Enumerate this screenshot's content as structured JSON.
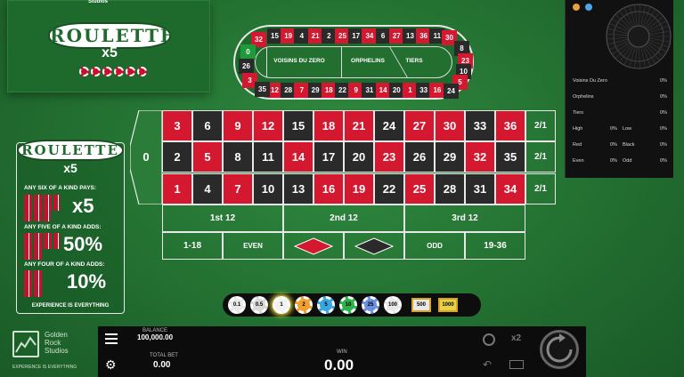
{
  "logo": {
    "brand_small": "Studios",
    "title": "ROULETTE",
    "multiplier": "x5"
  },
  "racetrack": {
    "top_numbers": [
      {
        "n": "15",
        "c": "black"
      },
      {
        "n": "19",
        "c": "red"
      },
      {
        "n": "4",
        "c": "black"
      },
      {
        "n": "21",
        "c": "red"
      },
      {
        "n": "2",
        "c": "black"
      },
      {
        "n": "25",
        "c": "red"
      },
      {
        "n": "17",
        "c": "black"
      },
      {
        "n": "34",
        "c": "red"
      },
      {
        "n": "6",
        "c": "black"
      },
      {
        "n": "27",
        "c": "red"
      },
      {
        "n": "13",
        "c": "black"
      },
      {
        "n": "36",
        "c": "red"
      },
      {
        "n": "11",
        "c": "black"
      }
    ],
    "bottom_numbers": [
      {
        "n": "12",
        "c": "red"
      },
      {
        "n": "28",
        "c": "black"
      },
      {
        "n": "7",
        "c": "red"
      },
      {
        "n": "29",
        "c": "black"
      },
      {
        "n": "18",
        "c": "red"
      },
      {
        "n": "22",
        "c": "black"
      },
      {
        "n": "9",
        "c": "red"
      },
      {
        "n": "31",
        "c": "black"
      },
      {
        "n": "14",
        "c": "red"
      },
      {
        "n": "20",
        "c": "black"
      },
      {
        "n": "1",
        "c": "red"
      },
      {
        "n": "33",
        "c": "black"
      },
      {
        "n": "16",
        "c": "red"
      }
    ],
    "left_numbers": [
      {
        "n": "32",
        "c": "red"
      },
      {
        "n": "0",
        "c": "green"
      },
      {
        "n": "26",
        "c": "black"
      },
      {
        "n": "3",
        "c": "red"
      },
      {
        "n": "35",
        "c": "black"
      }
    ],
    "right_numbers": [
      {
        "n": "30",
        "c": "red"
      },
      {
        "n": "8",
        "c": "black"
      },
      {
        "n": "23",
        "c": "red"
      },
      {
        "n": "10",
        "c": "black"
      },
      {
        "n": "5",
        "c": "red"
      },
      {
        "n": "24",
        "c": "black"
      }
    ],
    "labels": [
      "VOISINS DU ZERO",
      "ORPHELINS",
      "TIERS"
    ]
  },
  "history": {
    "rows": [
      {
        "label": "Voisins Du Zero",
        "value": "0%"
      },
      {
        "label": "Orphelins",
        "value": "0%"
      },
      {
        "label": "Tiers",
        "value": "0%"
      },
      {
        "label": "High",
        "value": "0%",
        "label2": "Low",
        "value2": "0%"
      },
      {
        "label": "Red",
        "value": "0%",
        "label2": "Black",
        "value2": "0%"
      },
      {
        "label": "Even",
        "value": "0%",
        "label2": "Odd",
        "value2": "0%"
      }
    ]
  },
  "table": {
    "zero": "0",
    "rows": [
      [
        {
          "n": "3",
          "c": "red"
        },
        {
          "n": "6",
          "c": "black"
        },
        {
          "n": "9",
          "c": "red"
        },
        {
          "n": "12",
          "c": "red"
        },
        {
          "n": "15",
          "c": "black"
        },
        {
          "n": "18",
          "c": "red"
        },
        {
          "n": "21",
          "c": "red"
        },
        {
          "n": "24",
          "c": "black"
        },
        {
          "n": "27",
          "c": "red"
        },
        {
          "n": "30",
          "c": "red"
        },
        {
          "n": "33",
          "c": "black"
        },
        {
          "n": "36",
          "c": "red"
        }
      ],
      [
        {
          "n": "2",
          "c": "black"
        },
        {
          "n": "5",
          "c": "red"
        },
        {
          "n": "8",
          "c": "black"
        },
        {
          "n": "11",
          "c": "black"
        },
        {
          "n": "14",
          "c": "red"
        },
        {
          "n": "17",
          "c": "black"
        },
        {
          "n": "20",
          "c": "black"
        },
        {
          "n": "23",
          "c": "red"
        },
        {
          "n": "26",
          "c": "black"
        },
        {
          "n": "29",
          "c": "black"
        },
        {
          "n": "32",
          "c": "red"
        },
        {
          "n": "35",
          "c": "black"
        }
      ],
      [
        {
          "n": "1",
          "c": "red"
        },
        {
          "n": "4",
          "c": "black"
        },
        {
          "n": "7",
          "c": "red"
        },
        {
          "n": "10",
          "c": "black"
        },
        {
          "n": "13",
          "c": "black"
        },
        {
          "n": "16",
          "c": "red"
        },
        {
          "n": "19",
          "c": "red"
        },
        {
          "n": "22",
          "c": "black"
        },
        {
          "n": "25",
          "c": "red"
        },
        {
          "n": "28",
          "c": "black"
        },
        {
          "n": "31",
          "c": "black"
        },
        {
          "n": "34",
          "c": "red"
        }
      ]
    ],
    "column_bets": [
      "2/1",
      "2/1",
      "2/1"
    ],
    "dozens": [
      "1st 12",
      "2nd 12",
      "3rd 12"
    ],
    "outside": {
      "low": "1-18",
      "even": "EVEN",
      "odd": "ODD",
      "high": "19-36"
    }
  },
  "paytable": {
    "title": "ROULETTE",
    "multiplier": "x5",
    "six_label": "ANY SIX OF A KIND PAYS:",
    "six_value": "x5",
    "five_label": "ANY FIVE OF A KIND ADDS:",
    "five_value": "50%",
    "four_label": "ANY FOUR OF A KIND ADDS:",
    "four_value": "10%",
    "tagline": "EXPERIENCE IS EVERYTHING"
  },
  "chips": [
    {
      "label": "0.1",
      "color": "#e8e8e8"
    },
    {
      "label": "0.5",
      "color": "#d9d9d9"
    },
    {
      "label": "1",
      "color": "#f2f2f2"
    },
    {
      "label": "2",
      "color": "#f0a030"
    },
    {
      "label": "5",
      "color": "#3aa6e0"
    },
    {
      "label": "10",
      "color": "#2bb34a"
    },
    {
      "label": "25",
      "color": "#6a8fe0"
    },
    {
      "label": "100",
      "color": "#e8e8e8"
    }
  ],
  "chips_rect": [
    {
      "label": "500",
      "color": "#e8e8e8"
    },
    {
      "label": "1000",
      "color": "#e8d24a"
    }
  ],
  "footer_brand": {
    "line1": "Golden",
    "line2": "Rock",
    "line3": "Studios",
    "tagline": "EXPERIENCE IS EVERYTHING"
  },
  "bottom": {
    "balance_label": "BALANCE",
    "balance_value": "100,000.00",
    "totalbet_label": "TOTAL BET",
    "totalbet_value": "0.00",
    "win_label": "WIN",
    "win_value": "0.00",
    "double_label": "x2"
  }
}
